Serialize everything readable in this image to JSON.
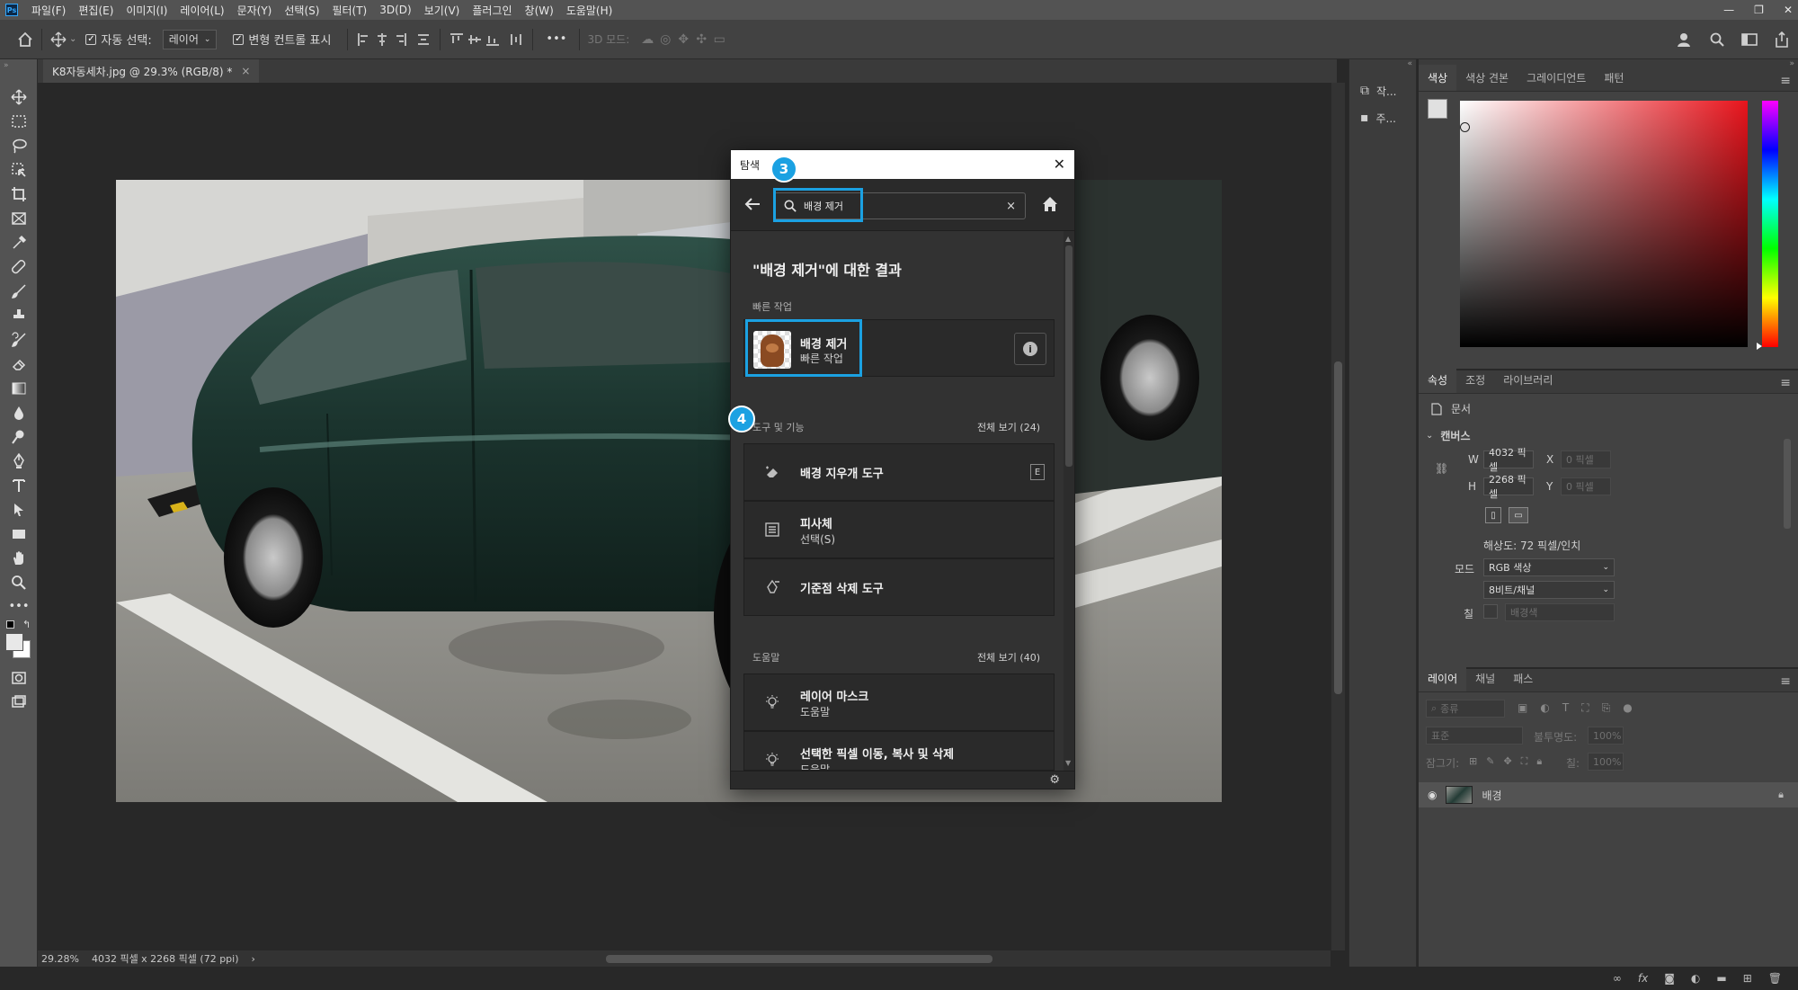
{
  "app": {
    "menus": [
      "파일(F)",
      "편집(E)",
      "이미지(I)",
      "레이어(L)",
      "문자(Y)",
      "선택(S)",
      "필터(T)",
      "3D(D)",
      "보기(V)",
      "플러그인",
      "창(W)",
      "도움말(H)"
    ],
    "window_controls": [
      "—",
      "❐",
      "✕"
    ]
  },
  "optionsbar": {
    "auto_select_label": "자동 선택:",
    "auto_select_value": "레이어",
    "transform_label": "변형 컨트롤 표시",
    "more": "•••",
    "mode_3d_label": "3D 모드:"
  },
  "document": {
    "tab_title": "K8자동세차.jpg @ 29.3% (RGB/8) *",
    "tab_close": "×"
  },
  "status": {
    "zoom": "29.28%",
    "dimensions": "4032 픽셀 x 2268 픽셀 (72 ppi)",
    "arrow": "›"
  },
  "narrow_panel": {
    "items": [
      "작...",
      "주..."
    ]
  },
  "color_panel": {
    "tabs": [
      "색상",
      "색상 견본",
      "그레이디언트",
      "패턴"
    ],
    "active_tab": "색상",
    "hue_color": "#e8141c"
  },
  "properties_panel": {
    "tabs": [
      "속성",
      "조정",
      "라이브러리"
    ],
    "doc_label": "문서",
    "canvas_section": "캔버스",
    "w_label": "W",
    "w_value": "4032 픽셀",
    "h_label": "H",
    "h_value": "2268 픽셀",
    "x_label": "X",
    "x_value": "0 픽셀",
    "y_label": "Y",
    "y_value": "0 픽셀",
    "resolution": "해상도: 72 픽셀/인치",
    "mode_label": "모드",
    "mode_value": "RGB 색상",
    "bit_value": "8비트/채널",
    "fill_label": "칠",
    "fill_value": "배경색"
  },
  "layers_panel": {
    "tabs": [
      "레이어",
      "채널",
      "패스"
    ],
    "kind_filter": "종류",
    "blend_mode": "표준",
    "opacity_label": "불투명도:",
    "opacity_value": "100%",
    "lock_label": "잠그기:",
    "fill_label": "칠:",
    "fill_value": "100%",
    "layer_name": "배경"
  },
  "discover": {
    "title": "탐색",
    "close": "✕",
    "search_value": "배경 제거",
    "search_clear": "×",
    "results_heading": "\"배경 제거\"에 대한 결과",
    "quick_actions_label": "빠른 작업",
    "quick_action": {
      "title": "배경 제거",
      "subtitle": "빠른 작업"
    },
    "tools_label": "도구 및 기능",
    "tools_see_all": "전체 보기 (24)",
    "tools": [
      {
        "title": "배경 지우개 도구",
        "subtitle": "",
        "shortcut": "E"
      },
      {
        "title": "피사체",
        "subtitle": "선택(S)",
        "shortcut": ""
      },
      {
        "title": "기준점 삭제 도구",
        "subtitle": "",
        "shortcut": ""
      }
    ],
    "help_label": "도움말",
    "help_see_all": "전체 보기 (40)",
    "help_items": [
      {
        "title": "레이어 마스크",
        "subtitle": "도움말"
      },
      {
        "title": "선택한 픽셀 이동, 복사 및 삭제",
        "subtitle": "도움말"
      }
    ],
    "step3": "3",
    "step4": "4"
  },
  "colors": {
    "highlight": "#1ba1e2",
    "car_body": "#1d3a33"
  }
}
